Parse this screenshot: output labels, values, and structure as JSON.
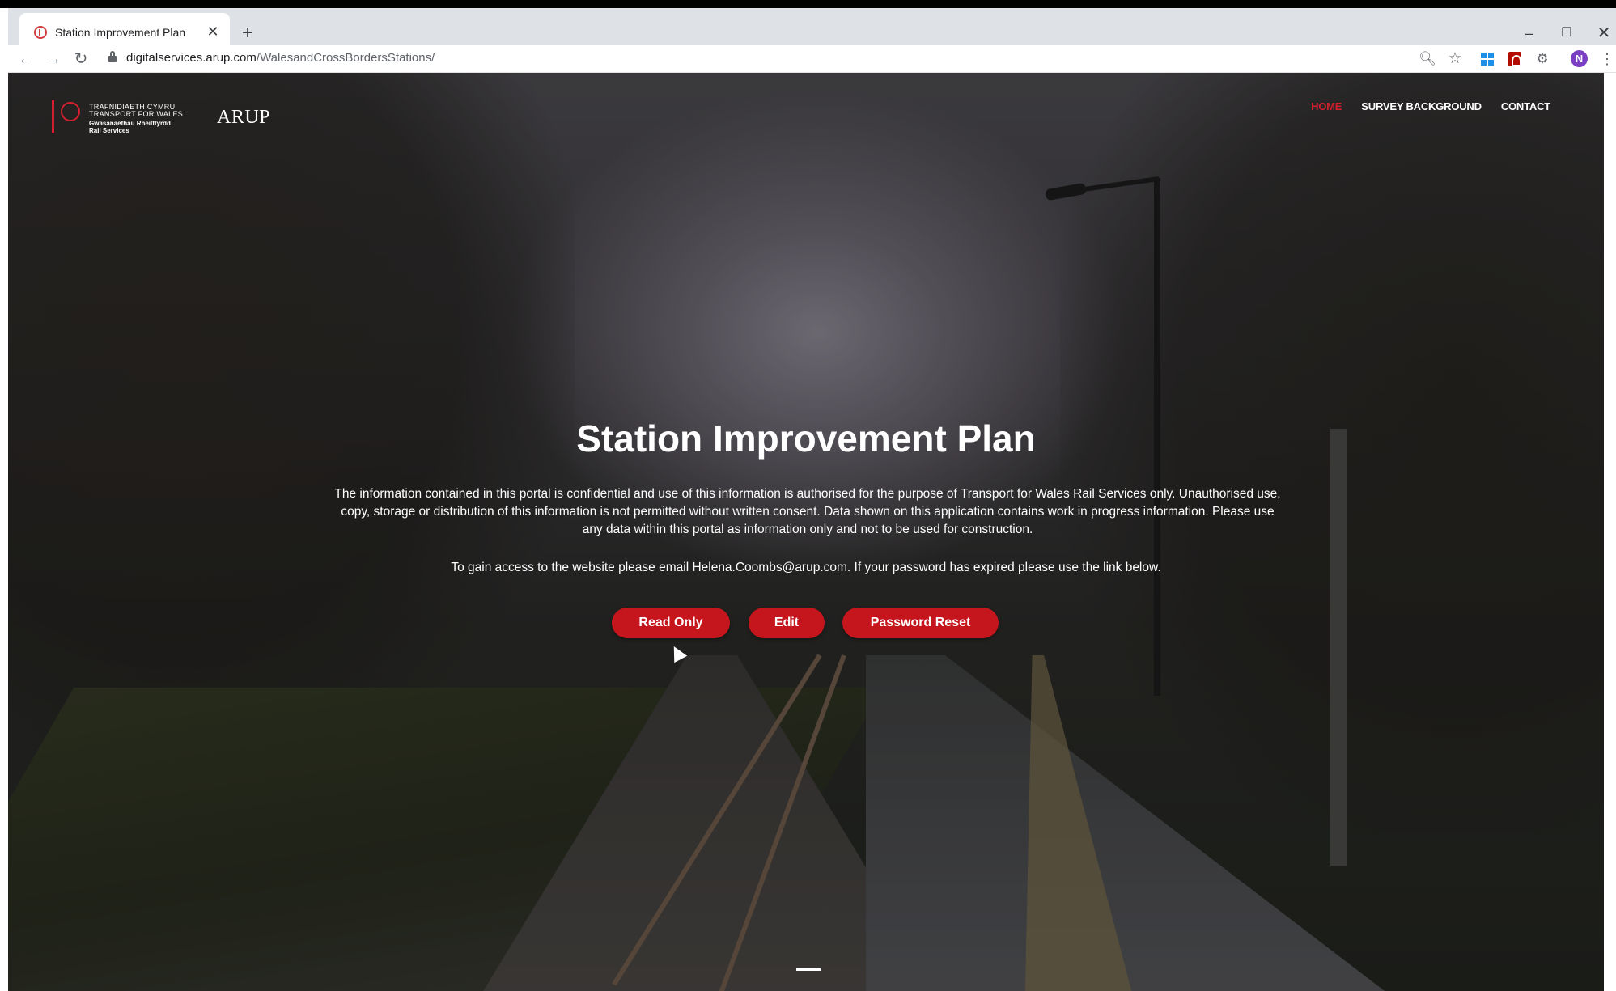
{
  "browser": {
    "tab_title": "Station Improvement Plan",
    "tab_close": "✕",
    "new_tab": "+",
    "url_host": "digitalservices.arup.com",
    "url_path": "/WalesandCrossBordersStations/",
    "avatar_initial": "N",
    "window_controls": {
      "minimize": "–",
      "maximize": "❐",
      "close": "✕"
    },
    "icons": [
      "back-arrow-icon",
      "forward-arrow-icon",
      "reload-icon",
      "lock-icon",
      "zoom-icon",
      "star-icon",
      "windows-extension-icon",
      "pdf-extension-icon",
      "gear-extension-icon",
      "kebab-menu-icon"
    ]
  },
  "site": {
    "logo_tfw": {
      "line1": "TRAFNIDIAETH CYMRU",
      "line2": "TRANSPORT FOR WALES",
      "line3": "Gwasanaethau Rheilffyrdd",
      "line4": "Rail Services"
    },
    "logo_arup": "ARUP",
    "nav": [
      {
        "label": "HOME",
        "active": true
      },
      {
        "label": "SURVEY BACKGROUND",
        "active": false
      },
      {
        "label": "CONTACT",
        "active": false
      }
    ],
    "accent_color": "#d31f2e"
  },
  "hero": {
    "title": "Station Improvement Plan",
    "disclaimer": "The information contained in this portal is confidential and use of this information is authorised for the purpose of Transport for Wales Rail Services only. Unauthorised use, copy, storage or distribution of this information is not permitted without written consent. Data shown on this application contains work in progress information. Please use any data within this portal as information only and not to be used for construction.",
    "access_note": "To gain access to the website please email Helena.Coombs@arup.com. If your password has expired please use the link below.",
    "buttons": {
      "read_only": "Read Only",
      "edit": "Edit",
      "password_reset": "Password Reset"
    },
    "button_color": "#c4161c"
  }
}
